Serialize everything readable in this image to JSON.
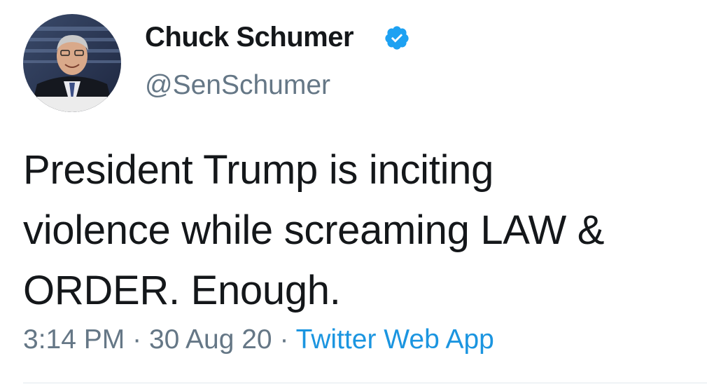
{
  "author": {
    "display_name": "Chuck Schumer",
    "handle": "@SenSchumer",
    "verified": true,
    "verified_badge_color": "#1da1f2"
  },
  "tweet": {
    "text_lines": [
      "President Trump is inciting",
      "violence while screaming LAW &",
      "ORDER. Enough."
    ],
    "time": "3:14 PM",
    "separator": "·",
    "date": "30 Aug 20",
    "source": "Twitter Web App"
  },
  "colors": {
    "text": "#14171a",
    "muted": "#657786",
    "link": "#1b95e0",
    "divider": "#e1e8ed"
  }
}
